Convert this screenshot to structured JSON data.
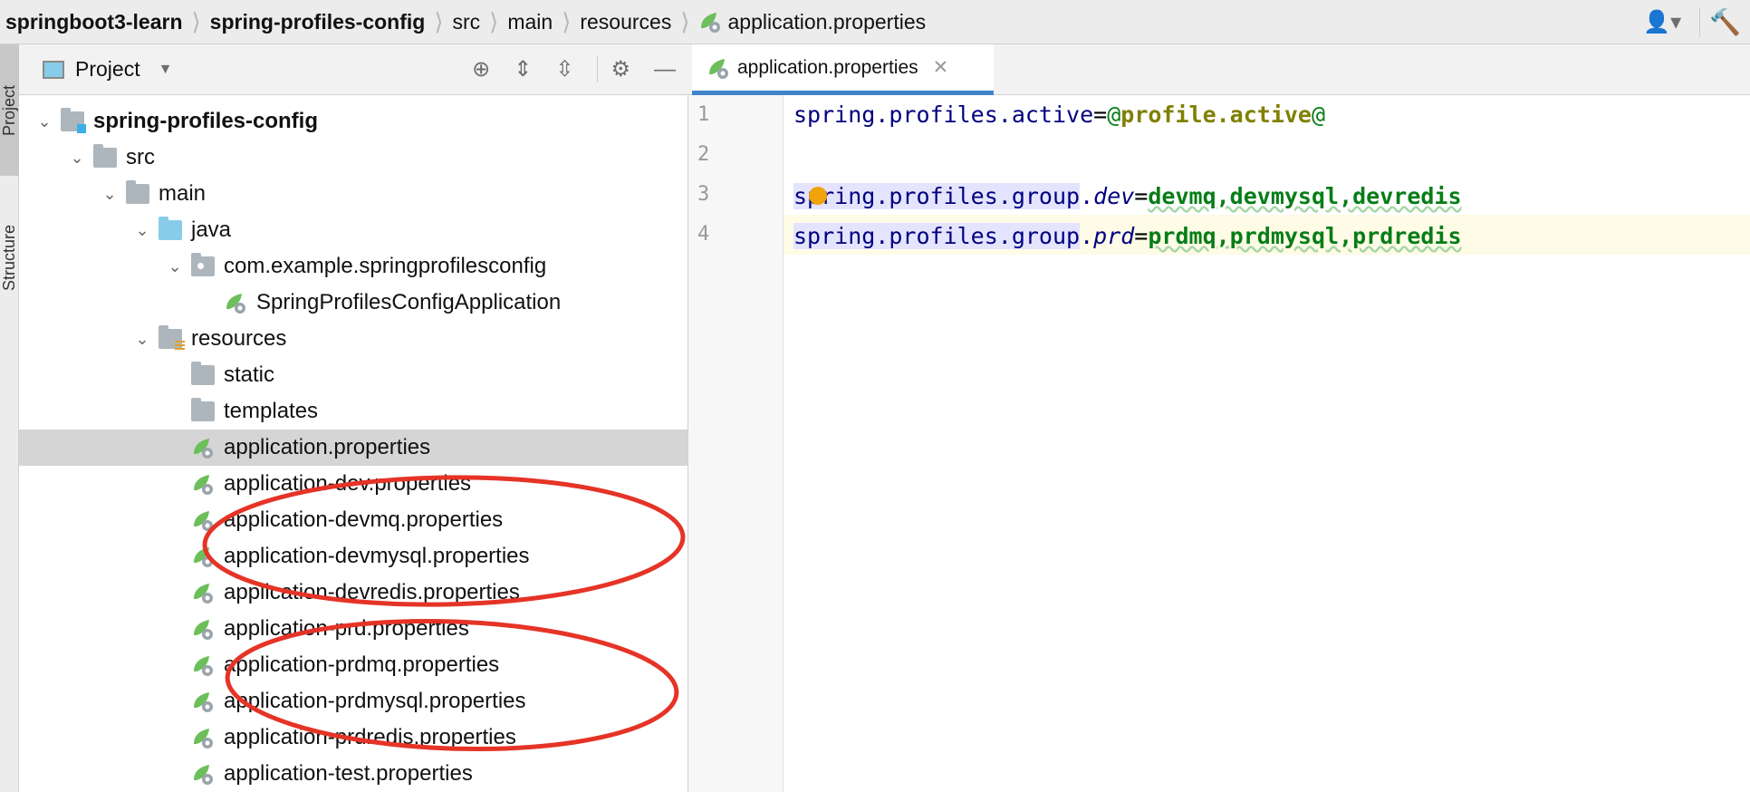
{
  "breadcrumb": [
    "springboot3-learn",
    "spring-profiles-config",
    "src",
    "main",
    "resources",
    "application.properties"
  ],
  "side_tabs": [
    "Project",
    "Structure"
  ],
  "project_panel": {
    "title": "Project"
  },
  "editor": {
    "tab": "application.properties",
    "line_numbers": [
      "1",
      "2",
      "3",
      "4"
    ],
    "lines": [
      [
        {
          "t": "spring.profiles.active",
          "c": "key"
        },
        {
          "t": "=",
          "c": "eq"
        },
        {
          "t": "@",
          "c": "at"
        },
        {
          "t": "profile.active",
          "c": "pv"
        },
        {
          "t": "@",
          "c": "at"
        }
      ],
      [],
      [
        {
          "t": "spring.profiles.group",
          "c": "key sel-k"
        },
        {
          "t": ".",
          "c": "key"
        },
        {
          "t": "dev",
          "c": "it"
        },
        {
          "t": "=",
          "c": "eq"
        },
        {
          "t": "devmq,devmysql,devredis",
          "c": "val"
        }
      ],
      [
        {
          "t": "spring.profiles.group",
          "c": "key sel-k"
        },
        {
          "t": ".",
          "c": "key"
        },
        {
          "t": "prd",
          "c": "it"
        },
        {
          "t": "=",
          "c": "eq"
        },
        {
          "t": "prdmq,prdmysql,prdredis",
          "c": "val"
        }
      ]
    ]
  },
  "tree": [
    {
      "level": 1,
      "icon": "module",
      "label": "spring-profiles-config",
      "expanded": true,
      "bold": true
    },
    {
      "level": 2,
      "icon": "folder",
      "label": "src",
      "expanded": true
    },
    {
      "level": 3,
      "icon": "folder",
      "label": "main",
      "expanded": true
    },
    {
      "level": 4,
      "icon": "source-folder",
      "label": "java",
      "expanded": true
    },
    {
      "level": 5,
      "icon": "package",
      "label": "com.example.springprofilesconfig",
      "expanded": true
    },
    {
      "level": 6,
      "icon": "spring-class",
      "label": "SpringProfilesConfigApplication"
    },
    {
      "level": 4,
      "icon": "resources-folder",
      "label": "resources",
      "expanded": true
    },
    {
      "level": 5,
      "icon": "folder",
      "label": "static"
    },
    {
      "level": 5,
      "icon": "folder",
      "label": "templates"
    },
    {
      "level": 5,
      "icon": "spring-properties",
      "label": "application.properties",
      "selected": true
    },
    {
      "level": 5,
      "icon": "spring-properties",
      "label": "application-dev.properties"
    },
    {
      "level": 5,
      "icon": "spring-properties",
      "label": "application-devmq.properties"
    },
    {
      "level": 5,
      "icon": "spring-properties",
      "label": "application-devmysql.properties"
    },
    {
      "level": 5,
      "icon": "spring-properties",
      "label": "application-devredis.properties"
    },
    {
      "level": 5,
      "icon": "spring-properties",
      "label": "application-prd.properties"
    },
    {
      "level": 5,
      "icon": "spring-properties",
      "label": "application-prdmq.properties"
    },
    {
      "level": 5,
      "icon": "spring-properties",
      "label": "application-prdmysql.properties"
    },
    {
      "level": 5,
      "icon": "spring-properties",
      "label": "application-prdredis.properties"
    },
    {
      "level": 5,
      "icon": "spring-properties",
      "label": "application-test.properties"
    }
  ],
  "annotation_color": "#e53427"
}
